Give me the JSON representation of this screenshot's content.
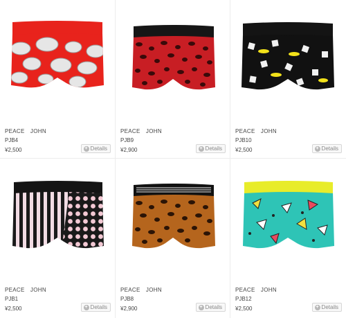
{
  "products": [
    {
      "brand": "PEACE　JOHN",
      "code": "PJB4",
      "price": "¥2,500",
      "details_label": "Details",
      "details_icon": "plus-circle-icon",
      "color": "#e8231c",
      "pattern": "clouds"
    },
    {
      "brand": "PEACE　JOHN",
      "code": "PJB9",
      "price": "¥2,900",
      "details_label": "Details",
      "details_icon": "plus-circle-icon",
      "color": "#c81e24",
      "pattern": "leopard-red"
    },
    {
      "brand": "PEACE　JOHN",
      "code": "PJB10",
      "price": "¥2,500",
      "details_label": "Details",
      "details_icon": "plus-circle-icon",
      "color": "#111111",
      "pattern": "dice"
    },
    {
      "brand": "PEACE　JOHN",
      "code": "PJB1",
      "price": "¥2,500",
      "details_label": "Details",
      "details_icon": "plus-circle-icon",
      "color": "#222222",
      "pattern": "stripes-dots"
    },
    {
      "brand": "PEACE　JOHN",
      "code": "PJB8",
      "price": "¥2,900",
      "details_label": "Details",
      "details_icon": "plus-circle-icon",
      "color": "#b5651d",
      "pattern": "leopard-brown"
    },
    {
      "brand": "PEACE　JOHN",
      "code": "PJB12",
      "price": "¥2,500",
      "details_label": "Details",
      "details_icon": "plus-circle-icon",
      "color": "#2ec4b6",
      "pattern": "retro-teal"
    }
  ]
}
